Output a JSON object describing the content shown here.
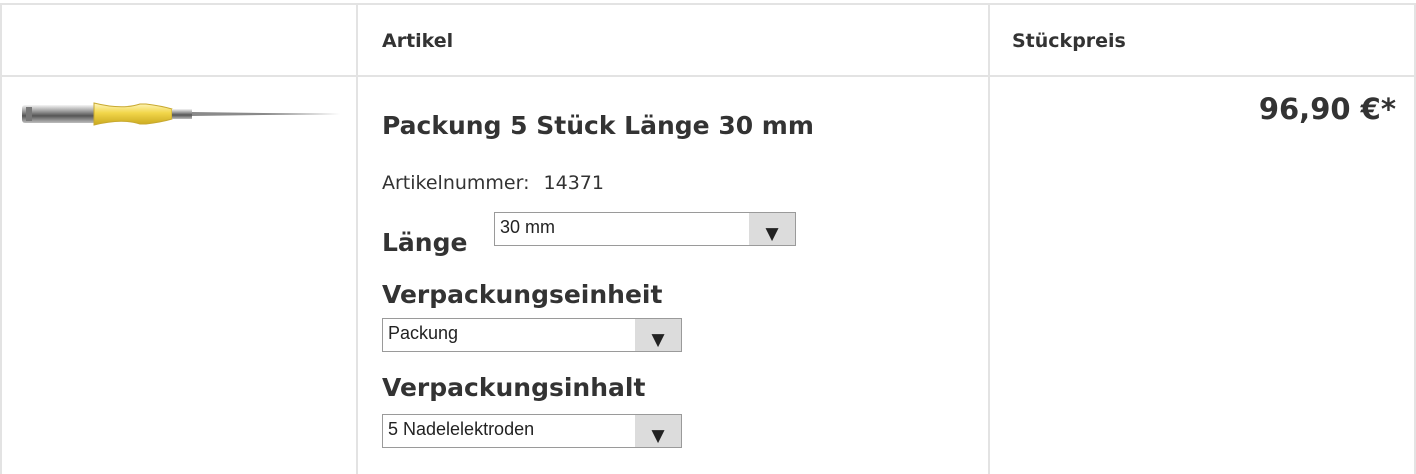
{
  "table": {
    "header": {
      "article_label": "Artikel",
      "unit_price_label": "Stückpreis"
    }
  },
  "product": {
    "image_icon": "needle-electrode-image",
    "title": "Packung 5 Stück Länge 30 mm",
    "article_number_label": "Artikelnummer:",
    "article_number": "14371",
    "price": "96,90 €*",
    "options": {
      "length": {
        "label": "Länge",
        "selected": "30 mm"
      },
      "packaging_unit": {
        "label": "Verpackungseinheit",
        "selected": "Packung"
      },
      "packaging_content": {
        "label": "Verpackungsinhalt",
        "selected": "5 Nadelelektroden"
      }
    }
  },
  "icons": {
    "dropdown_arrow": "▼"
  },
  "colors": {
    "border": "#e3e3e3",
    "text": "#333333",
    "select_button": "#dcdcdc",
    "handle": "#f2d64a"
  }
}
